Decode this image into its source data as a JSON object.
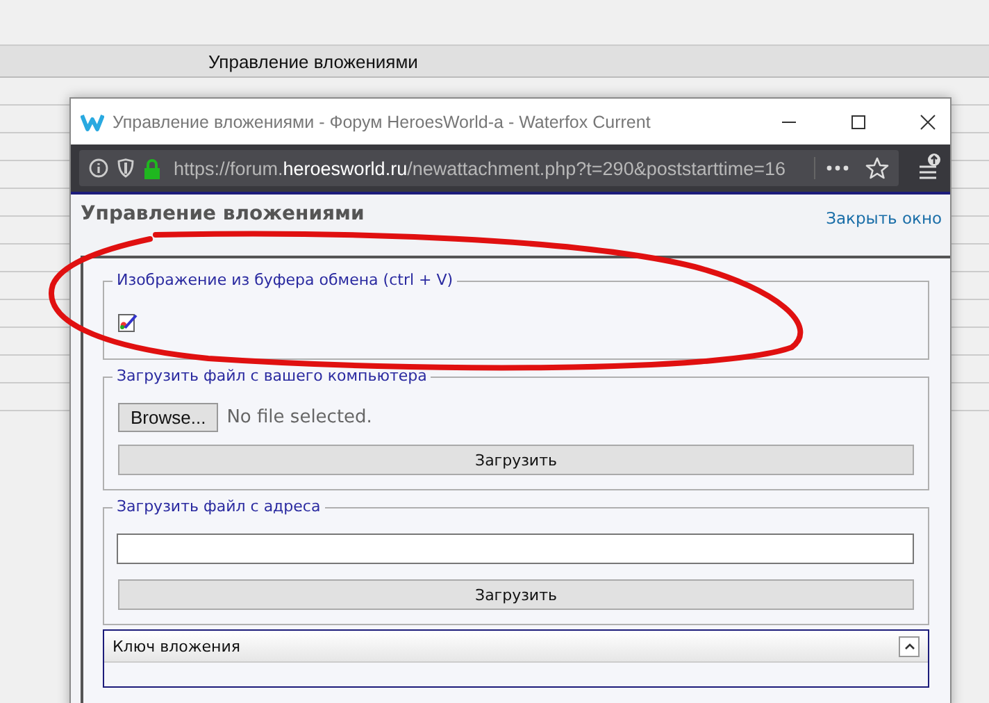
{
  "background_page": {
    "header_title": "Управление вложениями"
  },
  "window": {
    "title": "Управление вложениями - Форум HeroesWorld-a - Waterfox Current",
    "url": {
      "prefix": "https://forum.",
      "domain": "heroesworld.ru",
      "path": "/newattachment.php?t=290&poststarttime=16"
    }
  },
  "page": {
    "heading": "Управление вложениями",
    "close_link": "Закрыть окно",
    "sections": [
      {
        "kind": "clipboard",
        "legend": "Изображение из буфера обмена (ctrl + V)"
      },
      {
        "kind": "file",
        "legend": "Загрузить файл с вашего компьютера",
        "browse_label": "Browse...",
        "file_status": "No file selected.",
        "button": "Загрузить"
      },
      {
        "kind": "url",
        "legend": "Загрузить файл с адреса",
        "button": "Загрузить"
      }
    ],
    "key_panel": {
      "title": "Ключ вложения"
    }
  }
}
